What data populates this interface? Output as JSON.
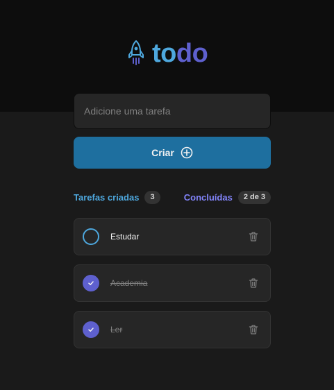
{
  "app": {
    "logo_text_part1": "to",
    "logo_text_part2": "do",
    "logo_icon": "rocket-icon"
  },
  "new_task": {
    "placeholder": "Adicione uma tarefa",
    "value": ""
  },
  "create_button": {
    "label": "Criar",
    "icon": "plus-circle-icon"
  },
  "summary": {
    "created_label": "Tarefas criadas",
    "created_count": "3",
    "done_label": "Concluídas",
    "done_count": "2 de 3"
  },
  "tasks": [
    {
      "text": "Estudar",
      "done": false
    },
    {
      "text": "Academia",
      "done": true
    },
    {
      "text": "Ler",
      "done": true
    }
  ],
  "colors": {
    "blue": "#4ea8de",
    "blue_dark": "#1e6f9f",
    "purple": "#5e60ce",
    "purple_light": "#8284fa",
    "background": "#1a1a1a",
    "header": "#0d0d0d",
    "card": "#262626"
  }
}
